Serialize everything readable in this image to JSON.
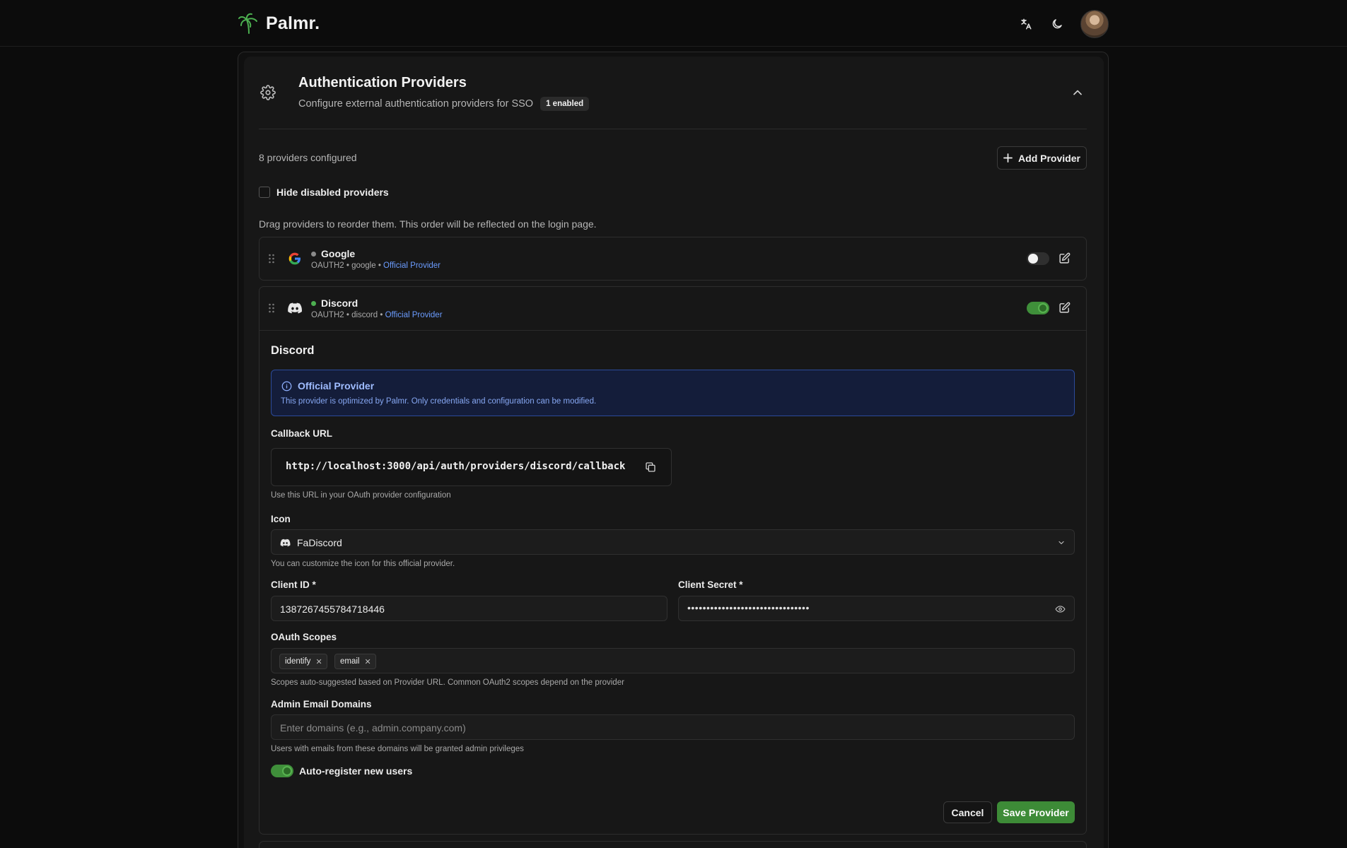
{
  "header": {
    "brand": "Palmr.",
    "icons": [
      "palm-logo-icon",
      "translate-icon",
      "moon-icon",
      "avatar"
    ]
  },
  "section": {
    "title": "Authentication Providers",
    "subtitle": "Configure external authentication providers for SSO",
    "badge": "1 enabled",
    "providers_count": "8 providers configured",
    "add_label": "Add Provider",
    "hide_disabled_label": "Hide disabled providers",
    "hide_disabled_checked": false,
    "drag_hint": "Drag providers to reorder them. This order will be reflected on the login page."
  },
  "providers": [
    {
      "name": "Google",
      "type": "OAUTH2",
      "slug": "google",
      "tag": "Official Provider",
      "enabled": false,
      "icon": "google-icon"
    },
    {
      "name": "Discord",
      "type": "OAUTH2",
      "slug": "discord",
      "tag": "Official Provider",
      "enabled": true,
      "icon": "discord-icon"
    }
  ],
  "editor": {
    "title": "Discord",
    "info_title": "Official Provider",
    "info_text": "This provider is optimized by Palmr. Only credentials and configuration can be modified.",
    "callback_label": "Callback URL",
    "callback_url": "http://localhost:3000/api/auth/providers/discord/callback",
    "callback_help": "Use this URL in your OAuth provider configuration",
    "icon_label": "Icon",
    "icon_value": "FaDiscord",
    "icon_help": "You can customize the icon for this official provider.",
    "client_id_label": "Client ID *",
    "client_id_value": "1387267455784718446",
    "client_secret_label": "Client Secret *",
    "client_secret_value": "••••••••••••••••••••••••••••••••",
    "scopes_label": "OAuth Scopes",
    "scopes": [
      "identify",
      "email"
    ],
    "scopes_help": "Scopes auto-suggested based on Provider URL. Common OAuth2 scopes depend on the provider",
    "admin_domains_label": "Admin Email Domains",
    "admin_domains_placeholder": "Enter domains (e.g., admin.company.com)",
    "admin_domains_help": "Users with emails from these domains will be granted admin privileges",
    "auto_register_label": "Auto-register new users",
    "auto_register_enabled": true,
    "cancel_label": "Cancel",
    "save_label": "Save Provider"
  },
  "colors": {
    "background": "#0c0c0c",
    "card": "#171717",
    "accent_green": "#3d8b37",
    "link_blue": "#6b9cff",
    "info_border": "#2b4a9a"
  }
}
